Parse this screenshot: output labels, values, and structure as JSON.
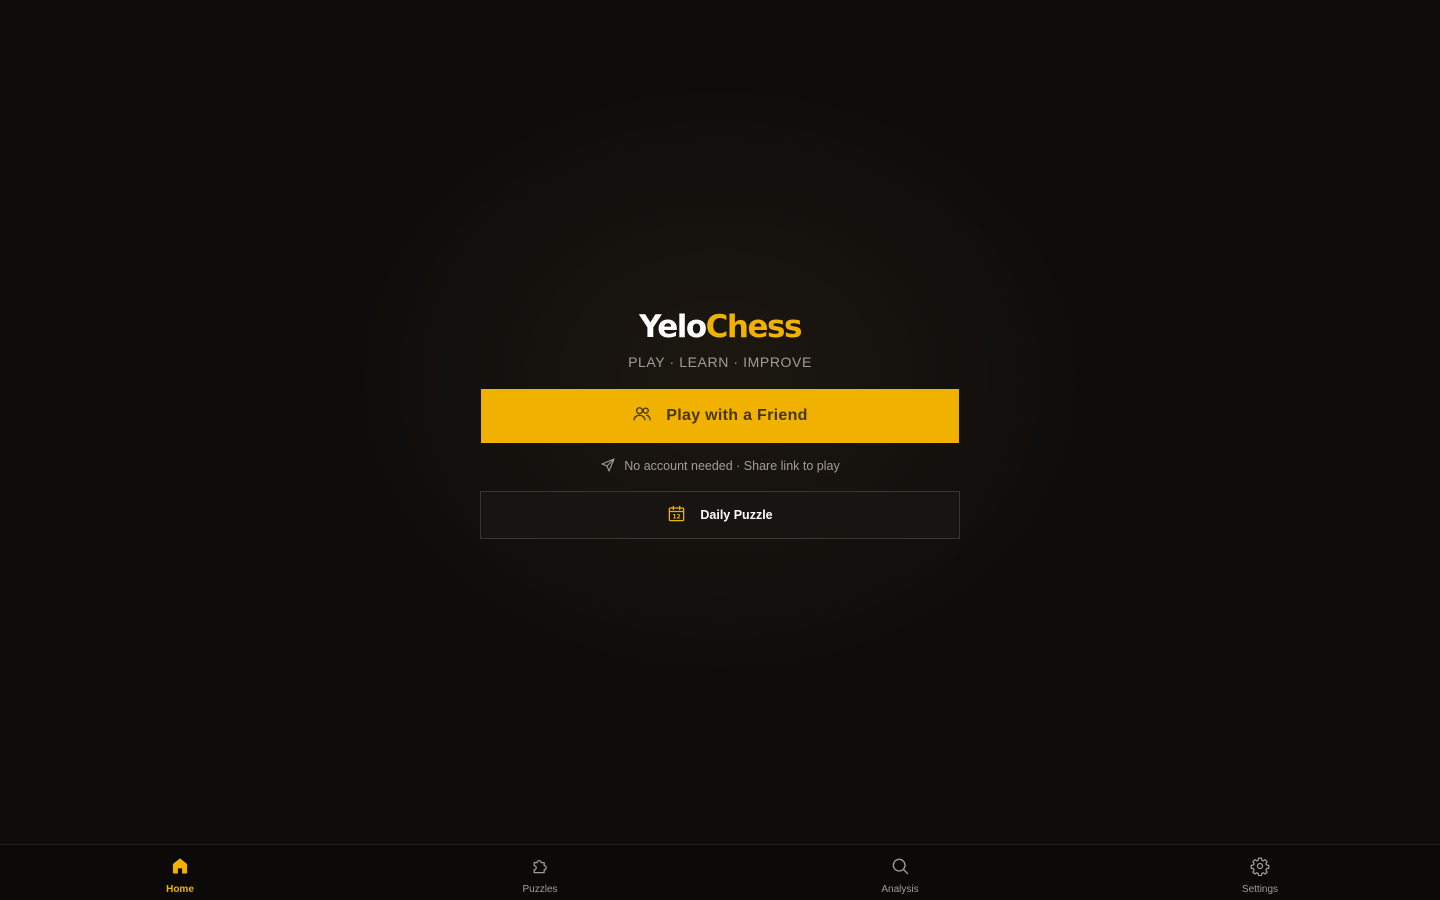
{
  "brand": {
    "name_part1": "Yelo",
    "name_part2": "Chess",
    "tagline": "PLAY · LEARN · IMPROVE"
  },
  "main": {
    "play_friend": {
      "label": "Play with a Friend",
      "icon": "users-icon"
    },
    "hint": {
      "text": "No account needed · Share link to play",
      "icon": "send-icon"
    },
    "daily_puzzle": {
      "label": "Daily Puzzle",
      "icon": "calendar-icon",
      "icon_text": "12"
    }
  },
  "tabs": [
    {
      "label": "Home",
      "icon": "home-icon",
      "active": true
    },
    {
      "label": "Puzzles",
      "icon": "puzzle-icon",
      "active": false
    },
    {
      "label": "Analysis",
      "icon": "search-icon",
      "active": false
    },
    {
      "label": "Settings",
      "icon": "gear-icon",
      "active": false
    }
  ],
  "colors": {
    "accent": "#f0b100",
    "background": "#0f0d0b",
    "text_muted": "#a39c92",
    "button_dark": "#171411"
  }
}
